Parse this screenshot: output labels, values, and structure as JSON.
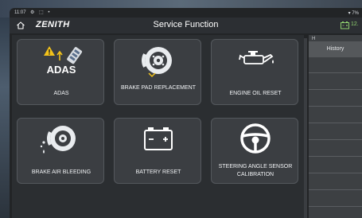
{
  "status_bar": {
    "time": "11:07",
    "icons": "⚙ ⬚ •",
    "right": "▾ 7%"
  },
  "header": {
    "logo": "ZENITH",
    "title": "Service Function",
    "battery_value": "12."
  },
  "tiles": [
    {
      "label": "ADAS",
      "icon_text": "ADAS",
      "icon": "adas-warning-icon"
    },
    {
      "label": "BRAKE PAD REPLACEMENT",
      "icon": "brake-disc-icon"
    },
    {
      "label": "ENGINE OIL RESET",
      "icon": "oil-can-icon"
    },
    {
      "label": "BRAKE AIR BLEEDING",
      "icon": "brake-bleed-icon"
    },
    {
      "label": "BATTERY RESET",
      "icon": "battery-icon"
    },
    {
      "label": "STEERING ANGLE SENSOR CALIBRATION",
      "icon": "steering-wheel-icon"
    }
  ],
  "history": {
    "marker": "H",
    "label": "History"
  },
  "colors": {
    "accent_green": "#8fd16f",
    "warning_yellow": "#f2c21b",
    "tile_bg": "#3b3e42"
  }
}
